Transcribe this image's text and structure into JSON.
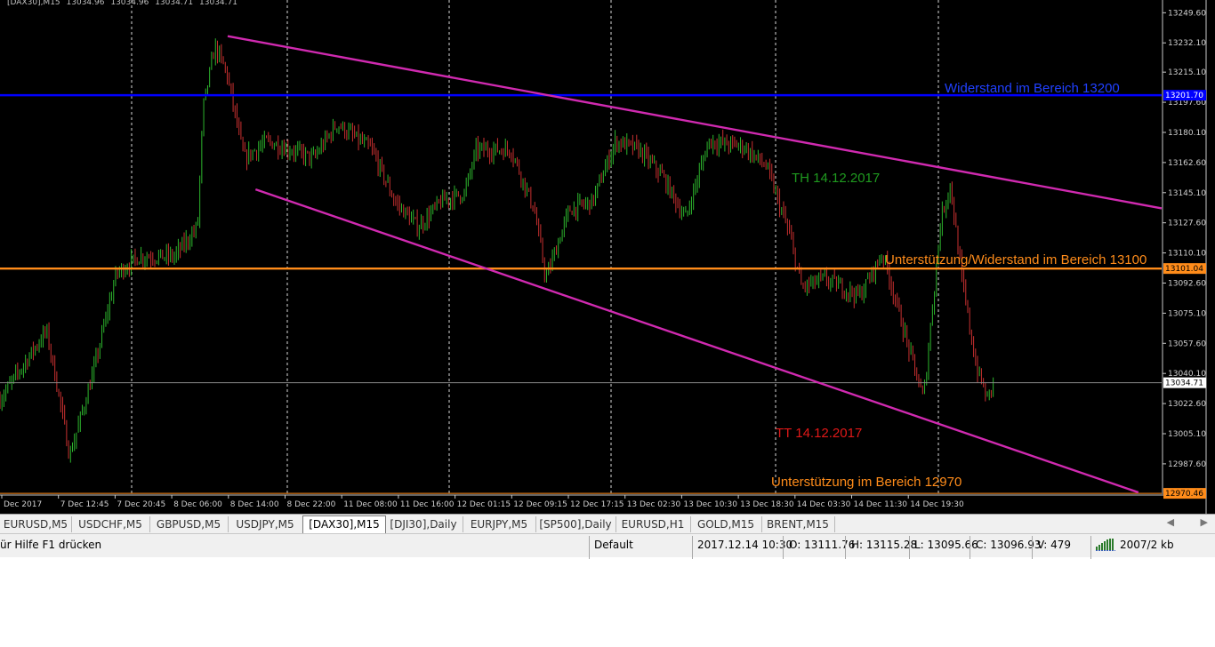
{
  "header": {
    "symbol": "[DAX30],M15",
    "ohlc": [
      "13034.96",
      "13034.96",
      "13034.71",
      "13034.71"
    ]
  },
  "colors": {
    "background": "#000000",
    "bull_candle": "#2db52d",
    "bear_candle": "#c83030",
    "resistance_line": "#0000ff",
    "support_line": "#ff8c1a",
    "trend_line": "#d02ab0",
    "annotation_green": "#1f9a1f",
    "annotation_red": "#e01818",
    "annotation_orange": "#ff8c1a",
    "annotation_blue": "#2040ff"
  },
  "chart_data": {
    "type": "candlestick",
    "symbol": "DAX30",
    "timeframe": "M15",
    "ylim": [
      12970.0,
      13257.0
    ],
    "y_ticks": [
      "13249.60",
      "13232.10",
      "13215.10",
      "13197.60",
      "13180.10",
      "13162.60",
      "13145.10",
      "13127.60",
      "13110.10",
      "13092.60",
      "13075.10",
      "13057.60",
      "13040.10",
      "13022.60",
      "13005.10",
      "12987.60"
    ],
    "x_ticks": [
      "Dec 2017",
      "7 Dec 12:45",
      "7 Dec 20:45",
      "8 Dec 06:00",
      "8 Dec 14:00",
      "8 Dec 22:00",
      "11 Dec 08:00",
      "11 Dec 16:00",
      "12 Dec 01:15",
      "12 Dec 09:15",
      "12 Dec 17:15",
      "13 Dec 02:30",
      "13 Dec 10:30",
      "13 Dec 18:30",
      "14 Dec 03:30",
      "14 Dec 11:30",
      "14 Dec 19:30"
    ],
    "grid": "vertical dotted at day separators",
    "current_price_label": "13034.71",
    "price_path": [
      {
        "x": 0,
        "y": 13025
      },
      {
        "x": 0.04,
        "y": 13065
      },
      {
        "x": 0.05,
        "y": 13030
      },
      {
        "x": 0.06,
        "y": 12992
      },
      {
        "x": 0.08,
        "y": 13040
      },
      {
        "x": 0.1,
        "y": 13098
      },
      {
        "x": 0.12,
        "y": 13108
      },
      {
        "x": 0.15,
        "y": 13108
      },
      {
        "x": 0.17,
        "y": 13125
      },
      {
        "x": 0.175,
        "y": 13195
      },
      {
        "x": 0.185,
        "y": 13230
      },
      {
        "x": 0.195,
        "y": 13215
      },
      {
        "x": 0.21,
        "y": 13165
      },
      {
        "x": 0.23,
        "y": 13175
      },
      {
        "x": 0.27,
        "y": 13165
      },
      {
        "x": 0.29,
        "y": 13185
      },
      {
        "x": 0.32,
        "y": 13170
      },
      {
        "x": 0.34,
        "y": 13140
      },
      {
        "x": 0.36,
        "y": 13125
      },
      {
        "x": 0.38,
        "y": 13140
      },
      {
        "x": 0.4,
        "y": 13145
      },
      {
        "x": 0.41,
        "y": 13170
      },
      {
        "x": 0.44,
        "y": 13170
      },
      {
        "x": 0.46,
        "y": 13135
      },
      {
        "x": 0.47,
        "y": 13095
      },
      {
        "x": 0.49,
        "y": 13135
      },
      {
        "x": 0.51,
        "y": 13140
      },
      {
        "x": 0.53,
        "y": 13175
      },
      {
        "x": 0.55,
        "y": 13170
      },
      {
        "x": 0.57,
        "y": 13155
      },
      {
        "x": 0.59,
        "y": 13130
      },
      {
        "x": 0.61,
        "y": 13175
      },
      {
        "x": 0.64,
        "y": 13172
      },
      {
        "x": 0.66,
        "y": 13160
      },
      {
        "x": 0.68,
        "y": 13120
      },
      {
        "x": 0.69,
        "y": 13090
      },
      {
        "x": 0.71,
        "y": 13095
      },
      {
        "x": 0.74,
        "y": 13085
      },
      {
        "x": 0.76,
        "y": 13110
      },
      {
        "x": 0.78,
        "y": 13060
      },
      {
        "x": 0.795,
        "y": 13025
      },
      {
        "x": 0.8,
        "y": 13060
      },
      {
        "x": 0.81,
        "y": 13130
      },
      {
        "x": 0.818,
        "y": 13150
      },
      {
        "x": 0.828,
        "y": 13095
      },
      {
        "x": 0.84,
        "y": 13045
      },
      {
        "x": 0.85,
        "y": 13025
      },
      {
        "x": 0.855,
        "y": 13035
      }
    ],
    "horizontal_levels": [
      {
        "name": "resistance",
        "value": 13201.7,
        "label": "Widerstand im Bereich 13200",
        "axis_label": "13201.70"
      },
      {
        "name": "support-resistance",
        "value": 13101.04,
        "label": "Unterstützung/Widerstand im Bereich 13100",
        "axis_label": "13101.04"
      },
      {
        "name": "support",
        "value": 12970.46,
        "label": "Unterstützung  im Bereich 12970",
        "axis_label": "12970.46"
      }
    ],
    "trend_lines": [
      {
        "name": "channel-upper",
        "from": {
          "x": 0.196,
          "y": 13236
        },
        "to": {
          "x": 1.0,
          "y": 13136
        }
      },
      {
        "name": "channel-lower",
        "from": {
          "x": 0.22,
          "y": 13147
        },
        "to": {
          "x": 0.98,
          "y": 12971
        }
      }
    ],
    "annotations": [
      {
        "name": "top-high",
        "text": "TH 14.12.2017"
      },
      {
        "name": "top-low",
        "text": "TT 14.12.2017"
      }
    ]
  },
  "tabs": [
    "EURUSD,M5",
    "USDCHF,M5",
    "GBPUSD,M5",
    "USDJPY,M5",
    "[DAX30],M15",
    "[DJI30],Daily",
    "EURJPY,M5",
    "[SP500],Daily",
    "EURUSD,H1",
    "GOLD,M15",
    "BRENT,M15"
  ],
  "active_tab": 4,
  "tab_scroll": {
    "left": "◀",
    "right": "▶"
  },
  "status": {
    "help": "ür Hilfe F1 drücken",
    "profile": "Default",
    "datetime": "2017.12.14 10:30",
    "open": "O: 13111.76",
    "high": "H: 13115.28",
    "low": "L: 13095.66",
    "close": "C: 13096.93",
    "volume": "V: 479",
    "traffic": "2007/2 kb",
    "connection_icon": "connection-bars-icon"
  }
}
